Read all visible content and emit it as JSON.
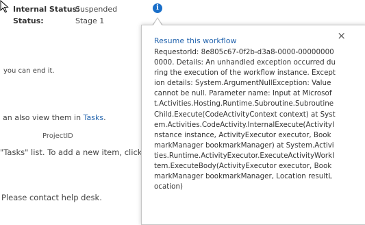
{
  "status_panel": {
    "internal_status_label": "Internal Status:",
    "internal_status_value": "Suspended",
    "status_label": "Status:",
    "status_value": "Stage 1"
  },
  "background": {
    "line1": "you can end it.",
    "line2_text": "an also view them in ",
    "line2_link": "Tasks",
    "line2_end": ".",
    "column_header": "ProjectID",
    "line3": "\"Tasks\" list. To add a new item, click \"Ne",
    "line4": "Please contact help desk."
  },
  "callout": {
    "resume_link": "Resume this workflow",
    "close_label": "×",
    "body": "RequestorId: 8e805c67-0f2b-d3a8-0000-000000000000. Details: An unhandled exception occurred during the execution of the workflow instance. Exception details: System.ArgumentNullException: Value cannot be null. Parameter name: Input at Microsoft.Activities.Hosting.Runtime.Subroutine.SubroutineChild.Execute(CodeActivityContext context) at System.Activities.CodeActivity.InternalExecute(ActivityInstance instance, ActivityExecutor executor, BookmarkManager bookmarkManager) at System.Activities.Runtime.ActivityExecutor.ExecuteActivityWorkItem.ExecuteBody(ActivityExecutor executor, BookmarkManager bookmarkManager, Location resultLocation)"
  },
  "icons": {
    "info": "info-icon",
    "cursor": "mouse-pointer-icon",
    "close": "close-icon"
  }
}
